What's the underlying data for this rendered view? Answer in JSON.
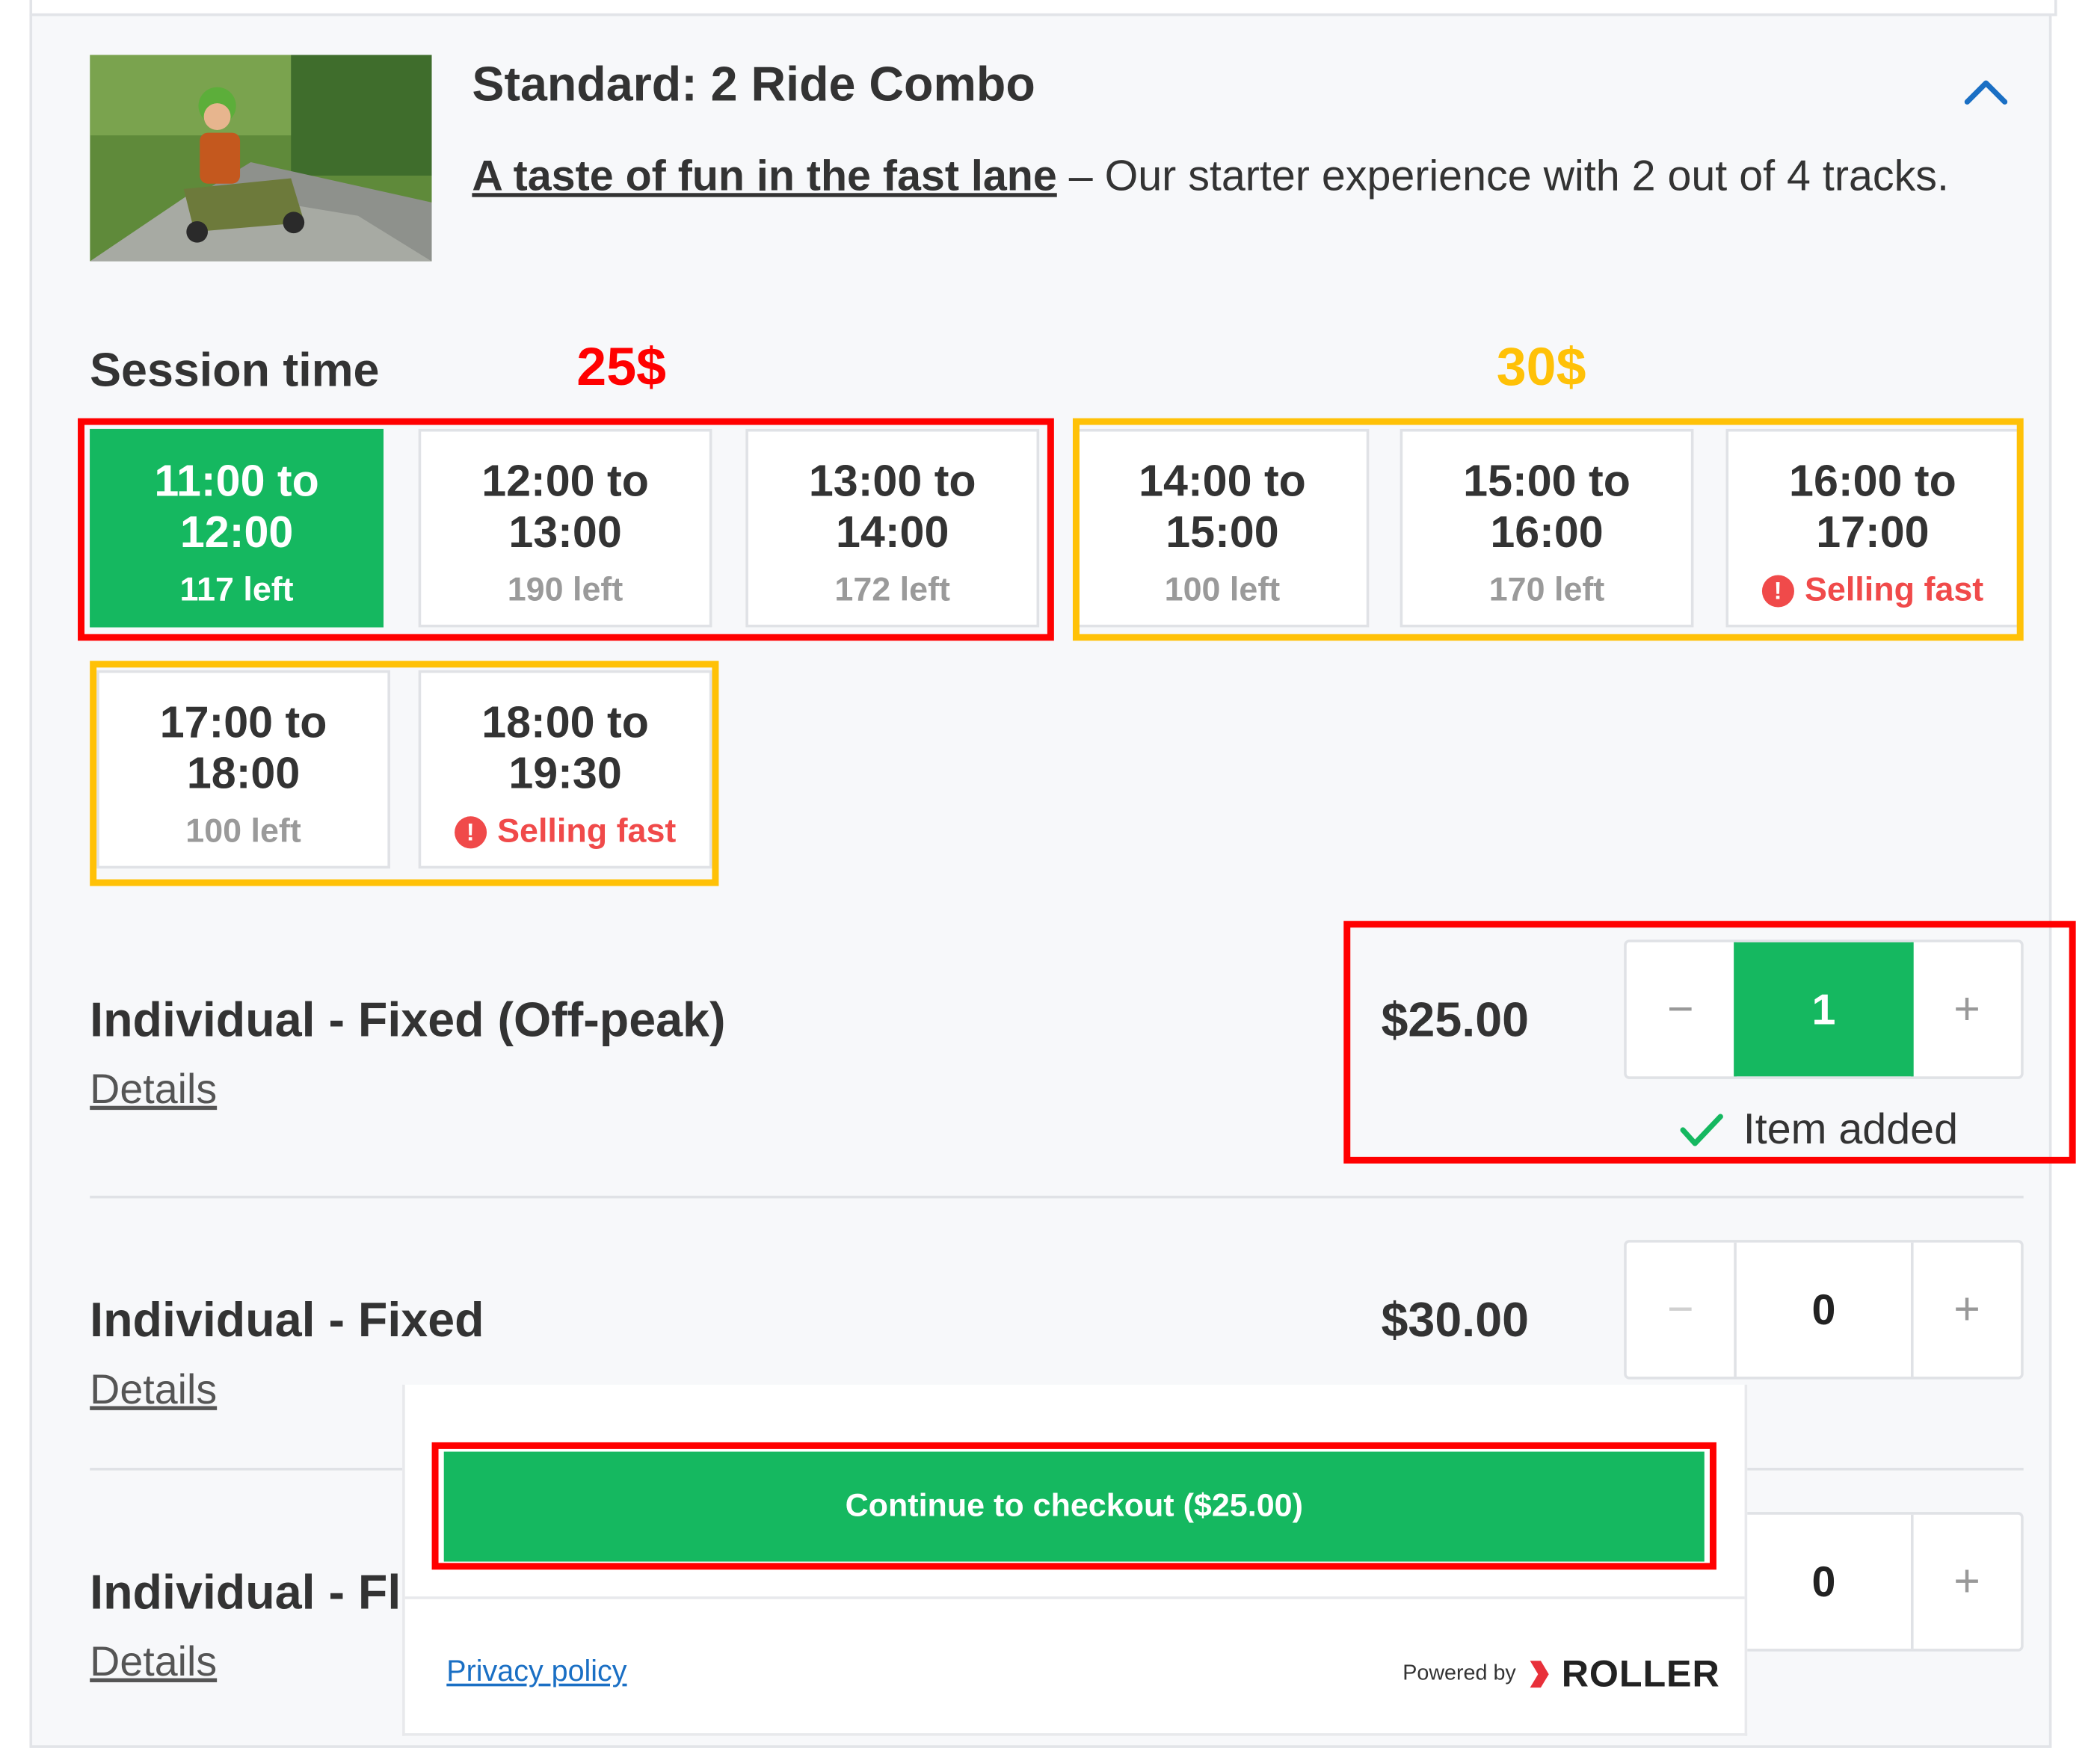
{
  "product": {
    "title": "Standard: 2 Ride Combo",
    "tagline_link": "A taste of fun in the fast lane",
    "description": " – Our starter experience with 2 out of 4 tracks."
  },
  "session": {
    "label": "Session time",
    "annotation_offpeak_price": "25$",
    "annotation_peak_price": "30$",
    "slots": [
      {
        "time": "11:00 to 12:00",
        "status": "117 left",
        "selected": true
      },
      {
        "time": "12:00 to 13:00",
        "status": "190 left"
      },
      {
        "time": "13:00 to 14:00",
        "status": "172 left"
      },
      {
        "time": "14:00 to 15:00",
        "status": "100 left"
      },
      {
        "time": "15:00 to 16:00",
        "status": "170 left"
      },
      {
        "time": "16:00 to 17:00",
        "status": "Selling fast",
        "selling_fast": true
      },
      {
        "time": "17:00 to 18:00",
        "status": "100 left"
      },
      {
        "time": "18:00 to 19:30",
        "status": "Selling fast",
        "selling_fast": true
      }
    ]
  },
  "tickets": [
    {
      "name": "Individual - Fixed (Off-peak)",
      "details": "Details",
      "price": "$25.00",
      "qty": "1",
      "minus": "−",
      "plus": "+",
      "added_msg": "Item added"
    },
    {
      "name": "Individual - Fixed",
      "details": "Details",
      "price": "$30.00",
      "qty": "0",
      "minus": "−",
      "plus": "+"
    },
    {
      "name": "Individual - Fl",
      "details": "Details",
      "qty": "0",
      "plus": "+"
    }
  ],
  "checkout": {
    "button_label": "Continue to checkout ($25.00)",
    "privacy": "Privacy policy",
    "powered_by": "Powered by",
    "brand": "ROLLER"
  },
  "colors": {
    "accent_green": "#15b860",
    "annotation_red": "#ff0000",
    "annotation_yellow": "#ffc107",
    "selling_fast_red": "#f04a4a",
    "link_blue": "#1a6fc4"
  }
}
